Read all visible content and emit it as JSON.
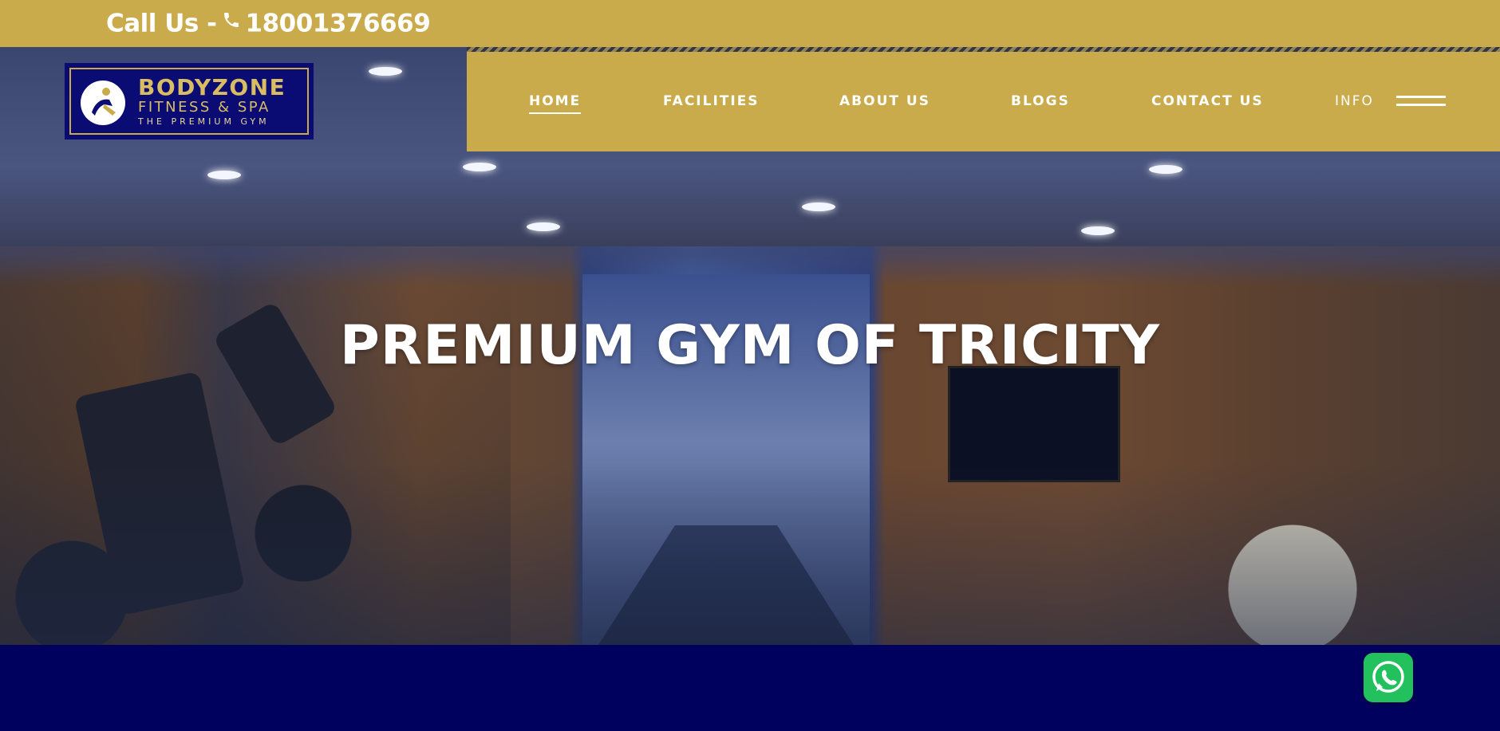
{
  "topbar": {
    "call_label": "Call Us -",
    "phone": "18001376669"
  },
  "logo": {
    "brand": "BODYZONE",
    "subtitle": "FITNESS & SPA",
    "tagline": "THE PREMIUM GYM"
  },
  "nav": {
    "items": [
      {
        "label": "HOME",
        "active": true
      },
      {
        "label": "FACILITIES",
        "active": false
      },
      {
        "label": "ABOUT US",
        "active": false
      },
      {
        "label": "BLOGS",
        "active": false
      },
      {
        "label": "CONTACT US",
        "active": false
      }
    ],
    "info_label": "INFO"
  },
  "hero": {
    "title": "PREMIUM GYM OF TRICITY"
  },
  "colors": {
    "gold": "#c9ab4c",
    "navy": "#00005e",
    "whatsapp": "#22c15e",
    "logo_bg": "#0b0b74"
  },
  "icons": {
    "phone": "phone-icon",
    "menu": "hamburger-menu-icon",
    "chat": "whatsapp-icon"
  }
}
